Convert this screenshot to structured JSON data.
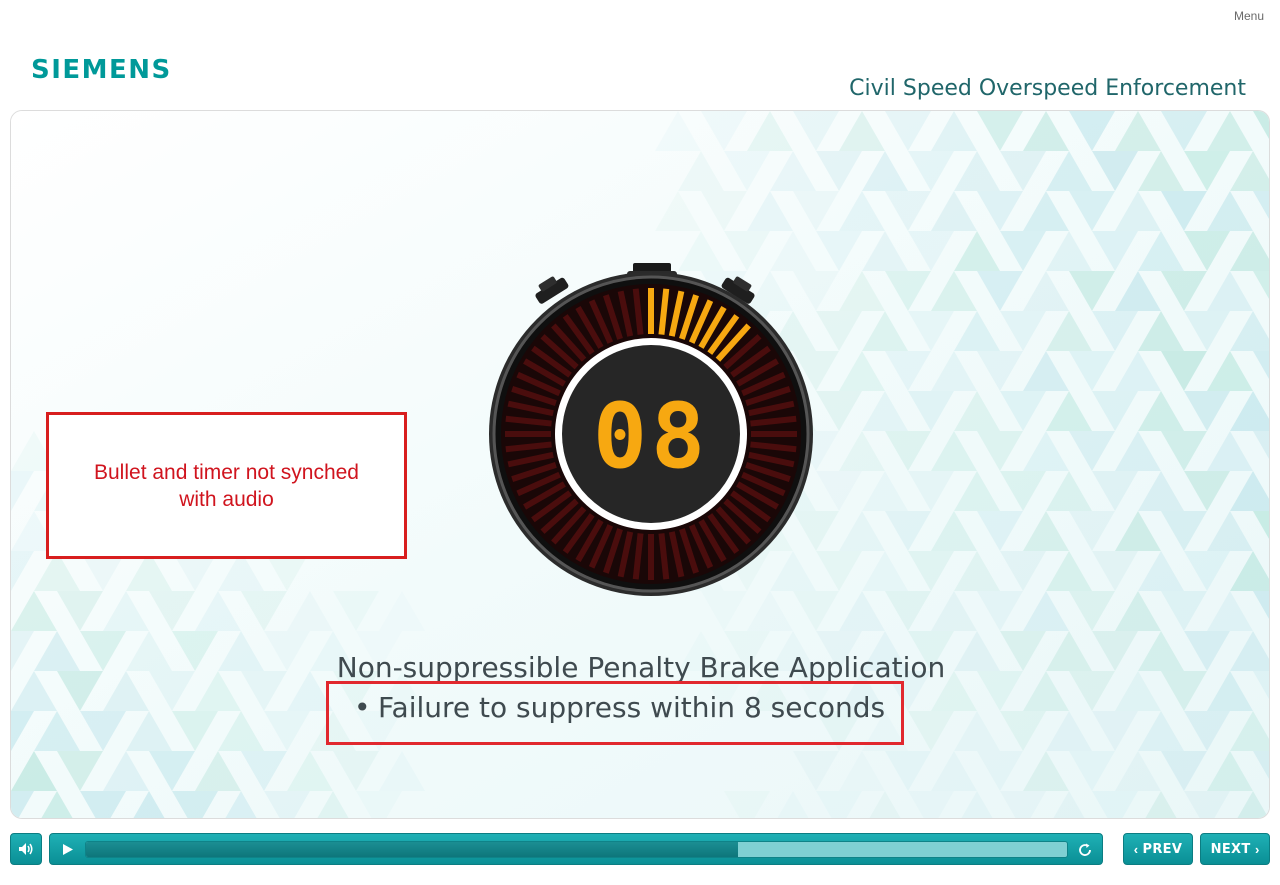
{
  "header": {
    "menu_label": "Menu",
    "brand": "SIEMENS",
    "course_title": "Civil Speed Overspeed Enforcement"
  },
  "slide": {
    "timer_value": "08",
    "timer_progress_fraction": 0.13,
    "heading": "Non-suppressible Penalty Brake Application",
    "bullets": [
      "Failure to suppress within 8 seconds"
    ],
    "bullet_symbol": "•"
  },
  "annotation": {
    "note_text": "Bullet and timer not synched with audio"
  },
  "player": {
    "progress_fraction": 0.665,
    "prev_label": "PREV",
    "next_label": "NEXT",
    "audio_icon": "speaker-icon",
    "play_icon": "play-icon",
    "replay_icon": "replay-icon"
  },
  "colors": {
    "brand_teal": "#009999",
    "title_teal": "#20666a",
    "button_teal": "#1aa5aa",
    "timer_orange": "#f7a811",
    "timer_dim_red": "#4a0d0d",
    "annotation_red": "#d81e1e"
  }
}
